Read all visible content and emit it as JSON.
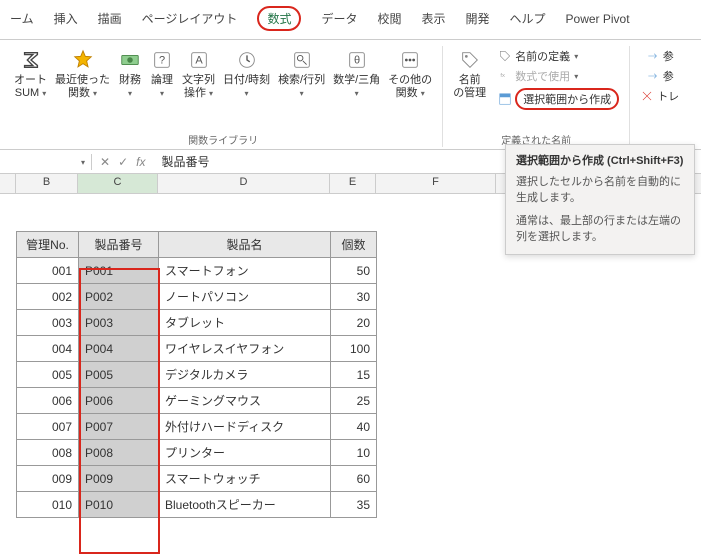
{
  "tabs": {
    "home": "ーム",
    "insert": "挿入",
    "draw": "描画",
    "layout": "ページレイアウト",
    "formula": "数式",
    "data": "データ",
    "review": "校閲",
    "view": "表示",
    "dev": "開発",
    "help": "ヘルプ",
    "pp": "Power Pivot"
  },
  "ribbon": {
    "autosum": "オート",
    "autosum2": "SUM",
    "recent": "最近使った",
    "recent2": "関数",
    "finance": "財務",
    "logic": "論理",
    "text": "文字列",
    "text2": "操作",
    "datetime": "日付/時刻",
    "lookup": "検索/行列",
    "math": "数学/三角",
    "more": "その他の",
    "more2": "関数",
    "funclib": "関数ライブラリ",
    "namemgr": "名前",
    "namemgr2": "の管理",
    "defname": "名前の定義",
    "usein": "数式で使用",
    "createfrom": "選択範囲から作成",
    "definednames": "定義された名前",
    "ref": "参",
    "tr": "トレ"
  },
  "fx": {
    "label": "fx",
    "value": "製品番号"
  },
  "cols": {
    "b": "B",
    "c": "C",
    "d": "D",
    "e": "E",
    "f": "F"
  },
  "headers": {
    "no": "管理No.",
    "code": "製品番号",
    "name": "製品名",
    "qty": "個数"
  },
  "rows": [
    {
      "no": "001",
      "code": "P001",
      "name": "スマートフォン",
      "qty": "50"
    },
    {
      "no": "002",
      "code": "P002",
      "name": "ノートパソコン",
      "qty": "30"
    },
    {
      "no": "003",
      "code": "P003",
      "name": "タブレット",
      "qty": "20"
    },
    {
      "no": "004",
      "code": "P004",
      "name": "ワイヤレスイヤフォン",
      "qty": "100"
    },
    {
      "no": "005",
      "code": "P005",
      "name": "デジタルカメラ",
      "qty": "15"
    },
    {
      "no": "006",
      "code": "P006",
      "name": "ゲーミングマウス",
      "qty": "25"
    },
    {
      "no": "007",
      "code": "P007",
      "name": "外付けハードディスク",
      "qty": "40"
    },
    {
      "no": "008",
      "code": "P008",
      "name": "プリンター",
      "qty": "10"
    },
    {
      "no": "009",
      "code": "P009",
      "name": "スマートウォッチ",
      "qty": "60"
    },
    {
      "no": "010",
      "code": "P010",
      "name": "Bluetoothスピーカー",
      "qty": "35"
    }
  ],
  "tooltip": {
    "title": "選択範囲から作成 (Ctrl+Shift+F3)",
    "l1": "選択したセルから名前を自動的に生成します。",
    "l2": "通常は、最上部の行または左端の列を選択します。"
  }
}
